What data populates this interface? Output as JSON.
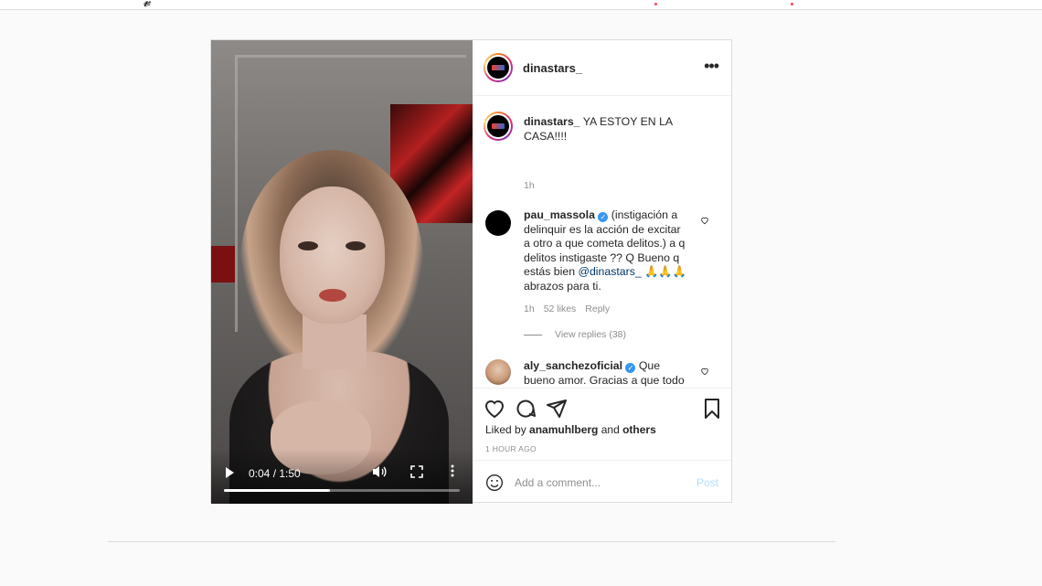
{
  "post": {
    "author": "dinastars_",
    "caption": {
      "username": "dinastars_",
      "text": " YA ESTOY EN LA CASA!!!!",
      "time": "1h"
    },
    "video": {
      "time_display": "0:04 / 1:50",
      "progress": 0.45
    },
    "comments": [
      {
        "username": "pau_massola",
        "verified": true,
        "text_before_mention": " (instigación a delinquir es la acción de excitar a otro a que cometa delitos.) a q delitos instigaste ?? Q Bueno q estás bien ",
        "mention": "@dinastars_",
        "text_after_mention": " 🙏🙏🙏 abrazos para ti.",
        "time": "1h",
        "likes": "52 likes",
        "reply": "Reply",
        "view_replies": "View replies (38)"
      },
      {
        "username": "aly_sanchezoficial",
        "verified": true,
        "text": " Que bueno amor. Gracias a que todo el mundo dijo que estabas secuestrada (porque cuando no sabes a donde vas ni puedes decir"
      }
    ],
    "liked_by": {
      "prefix": "Liked by ",
      "user": "anamuhlberg",
      "middle": " and ",
      "others": "others"
    },
    "timestamp": "1 HOUR AGO",
    "add_comment": {
      "placeholder": "Add a comment...",
      "post_label": "Post"
    }
  },
  "icons": [
    "more-options-icon",
    "like-icon",
    "comment-icon",
    "share-icon",
    "save-icon",
    "emoji-icon",
    "play-icon",
    "volume-icon",
    "fullscreen-icon",
    "verified-icon",
    "heart-small-icon"
  ],
  "colors": {
    "accent_link": "#00376b",
    "verified": "#3897f0",
    "post_button_disabled": "#b2dffc",
    "muted_text": "#8e8e8e"
  }
}
